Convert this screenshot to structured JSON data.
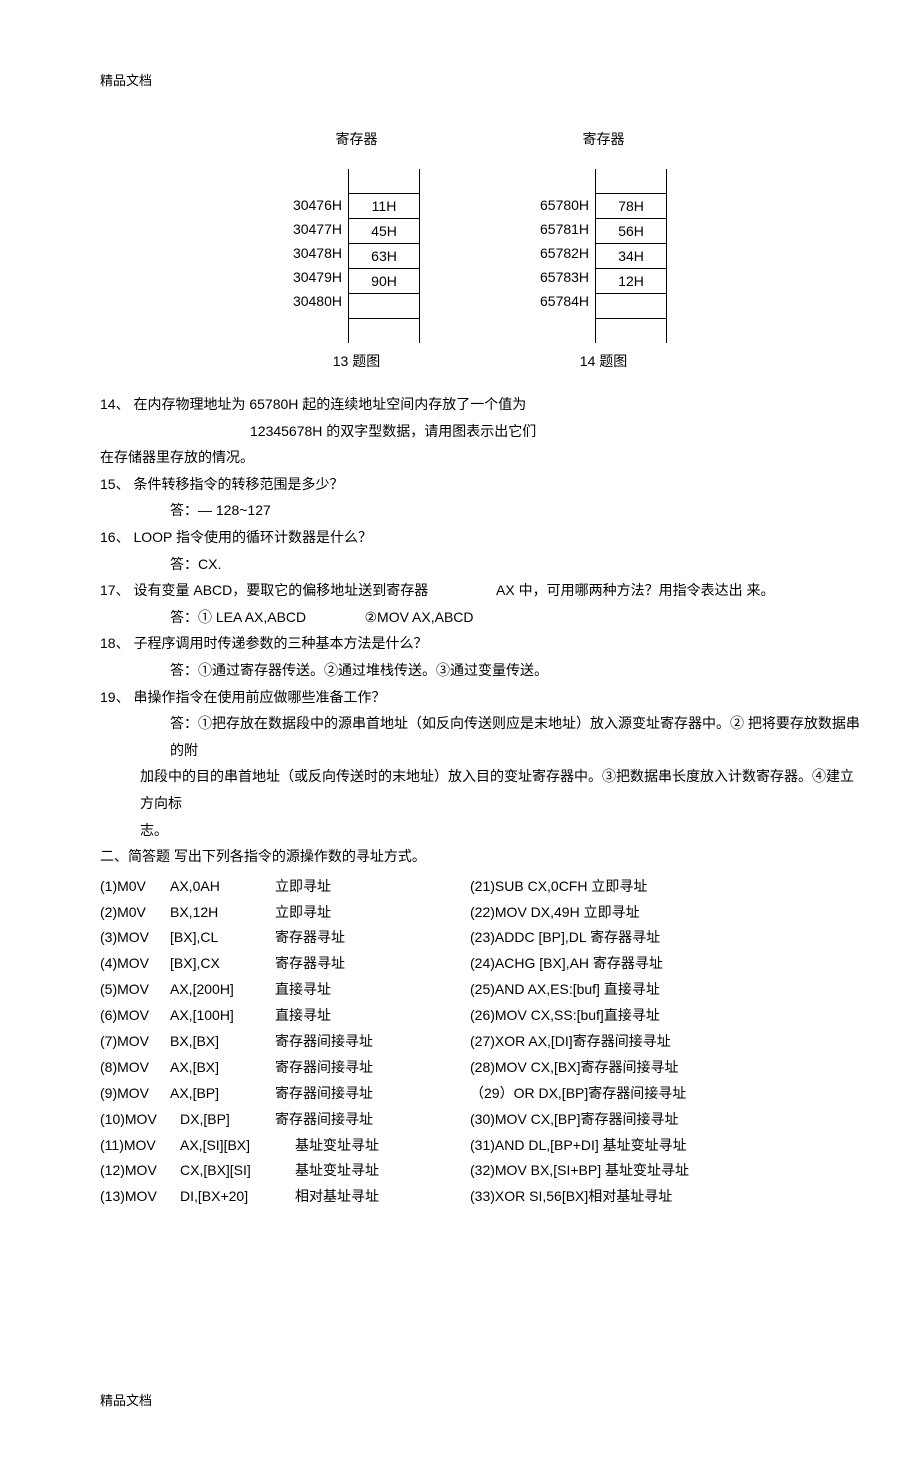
{
  "header": "精品文档",
  "footer": "精品文档",
  "diagram13": {
    "title": "寄存器",
    "rows": [
      {
        "addr": "",
        "val": ""
      },
      {
        "addr": "30476H",
        "val": "11H"
      },
      {
        "addr": "30477H",
        "val": "45H"
      },
      {
        "addr": "30478H",
        "val": "63H"
      },
      {
        "addr": "30479H",
        "val": "90H"
      },
      {
        "addr": "30480H",
        "val": ""
      },
      {
        "addr": "",
        "val": ""
      }
    ],
    "caption": "13 题图"
  },
  "diagram14": {
    "title": "寄存器",
    "rows": [
      {
        "addr": "",
        "val": ""
      },
      {
        "addr": "65780H",
        "val": "78H"
      },
      {
        "addr": "65781H",
        "val": "56H"
      },
      {
        "addr": "65782H",
        "val": "34H"
      },
      {
        "addr": "65783H",
        "val": "12H"
      },
      {
        "addr": "65784H",
        "val": ""
      },
      {
        "addr": "",
        "val": ""
      }
    ],
    "caption": "14 题图"
  },
  "q14": {
    "lead": "14、 在内存物理地址为 65780H 起的连续地址空间内存放了一个值为",
    "tail": "12345678H 的双字型数据，请用图表示出它们",
    "line2": "在存储器里存放的情况。"
  },
  "q15": {
    "q": "15、 条件转移指令的转移范围是多少？",
    "a": "答：— 128~127"
  },
  "q16": {
    "q": "16、 LOOP 指令使用的循环计数器是什么？",
    "a": "答：CX."
  },
  "q17": {
    "q_lead": "17、 设有变量 ABCD，要取它的偏移地址送到寄存器",
    "q_mid": "AX 中，可用哪两种方法？用指令表达出 来。",
    "a": "答：① LEA AX,ABCD               ②MOV AX,ABCD"
  },
  "q18": {
    "q": "18、 子程序调用时传递参数的三种基本方法是什么？",
    "a": "答：①通过寄存器传送。②通过堆栈传送。③通过变量传送。"
  },
  "q19": {
    "q": "19、 串操作指令在使用前应做哪些准备工作？",
    "a1": "答：①把存放在数据段中的源串首地址（如反向传送则应是末地址）放入源变址寄存器中。② 把将要存放数据串的附",
    "a2": "加段中的目的串首地址（或反向传送时的末地址）放入目的变址寄存器中。③把数据串长度放入计数寄存器。④建立方向标",
    "a3": "志。"
  },
  "section2": "二、简答题 写出下列各指令的源操作数的寻址方式。",
  "left": [
    {
      "n": "(1)M0V",
      "op": "AX,0AH",
      "mode": "立即寻址"
    },
    {
      "n": "(2)M0V",
      "op": "BX,12H",
      "mode": "立即寻址"
    },
    {
      "n": "(3)MOV",
      "op": "[BX],CL",
      "mode": "寄存器寻址"
    },
    {
      "n": "(4)MOV",
      "op": "[BX],CX",
      "mode": "寄存器寻址"
    },
    {
      "n": "(5)MOV",
      "op": "AX,[200H]",
      "mode": "直接寻址"
    },
    {
      "n": "(6)MOV",
      "op": "AX,[100H]",
      "mode": "直接寻址"
    },
    {
      "n": "(7)MOV",
      "op": "BX,[BX]",
      "mode": "寄存器间接寻址"
    },
    {
      "n": "(8)MOV",
      "op": "AX,[BX]",
      "mode": "寄存器间接寻址"
    },
    {
      "n": "(9)MOV",
      "op": "AX,[BP]",
      "mode": "寄存器间接寻址"
    },
    {
      "n": "(10)MOV",
      "op": "DX,[BP]",
      "mode": "寄存器间接寻址"
    },
    {
      "n": "(11)MOV",
      "op": "AX,[SI][BX]",
      "mode": "基址变址寻址"
    },
    {
      "n": "(12)MOV",
      "op": "CX,[BX][SI]",
      "mode": "基址变址寻址"
    },
    {
      "n": "(13)MOV",
      "op": "DI,[BX+20]",
      "mode": "相对基址寻址"
    }
  ],
  "right": [
    {
      "text": "(21)SUB CX,0CFH 立即寻址"
    },
    {
      "text": "(22)MOV     DX,49H 立即寻址"
    },
    {
      "text": "(23)ADDC     [BP],DL 寄存器寻址"
    },
    {
      "text": "(24)ACHG     [BX],AH 寄存器寻址"
    },
    {
      "text": "(25)AND    AX,ES:[buf] 直接寻址"
    },
    {
      "text": "(26)MOV     CX,SS:[buf]直接寻址"
    },
    {
      "text": "(27)XOR    AX,[DI]寄存器间接寻址"
    },
    {
      "text": "(28)MOV     CX,[BX]寄存器间接寻址"
    },
    {
      "text": "（29）OR DX,[BP]寄存器间接寻址"
    },
    {
      "text": "(30)MOV     CX,[BP]寄存器间接寻址"
    },
    {
      "text": "(31)AND    DL,[BP+DI] 基址变址寻址"
    },
    {
      "text": "(32)MOV     BX,[SI+BP] 基址变址寻址"
    },
    {
      "text": "(33)XOR    SI,56[BX]相对基址寻址"
    }
  ]
}
